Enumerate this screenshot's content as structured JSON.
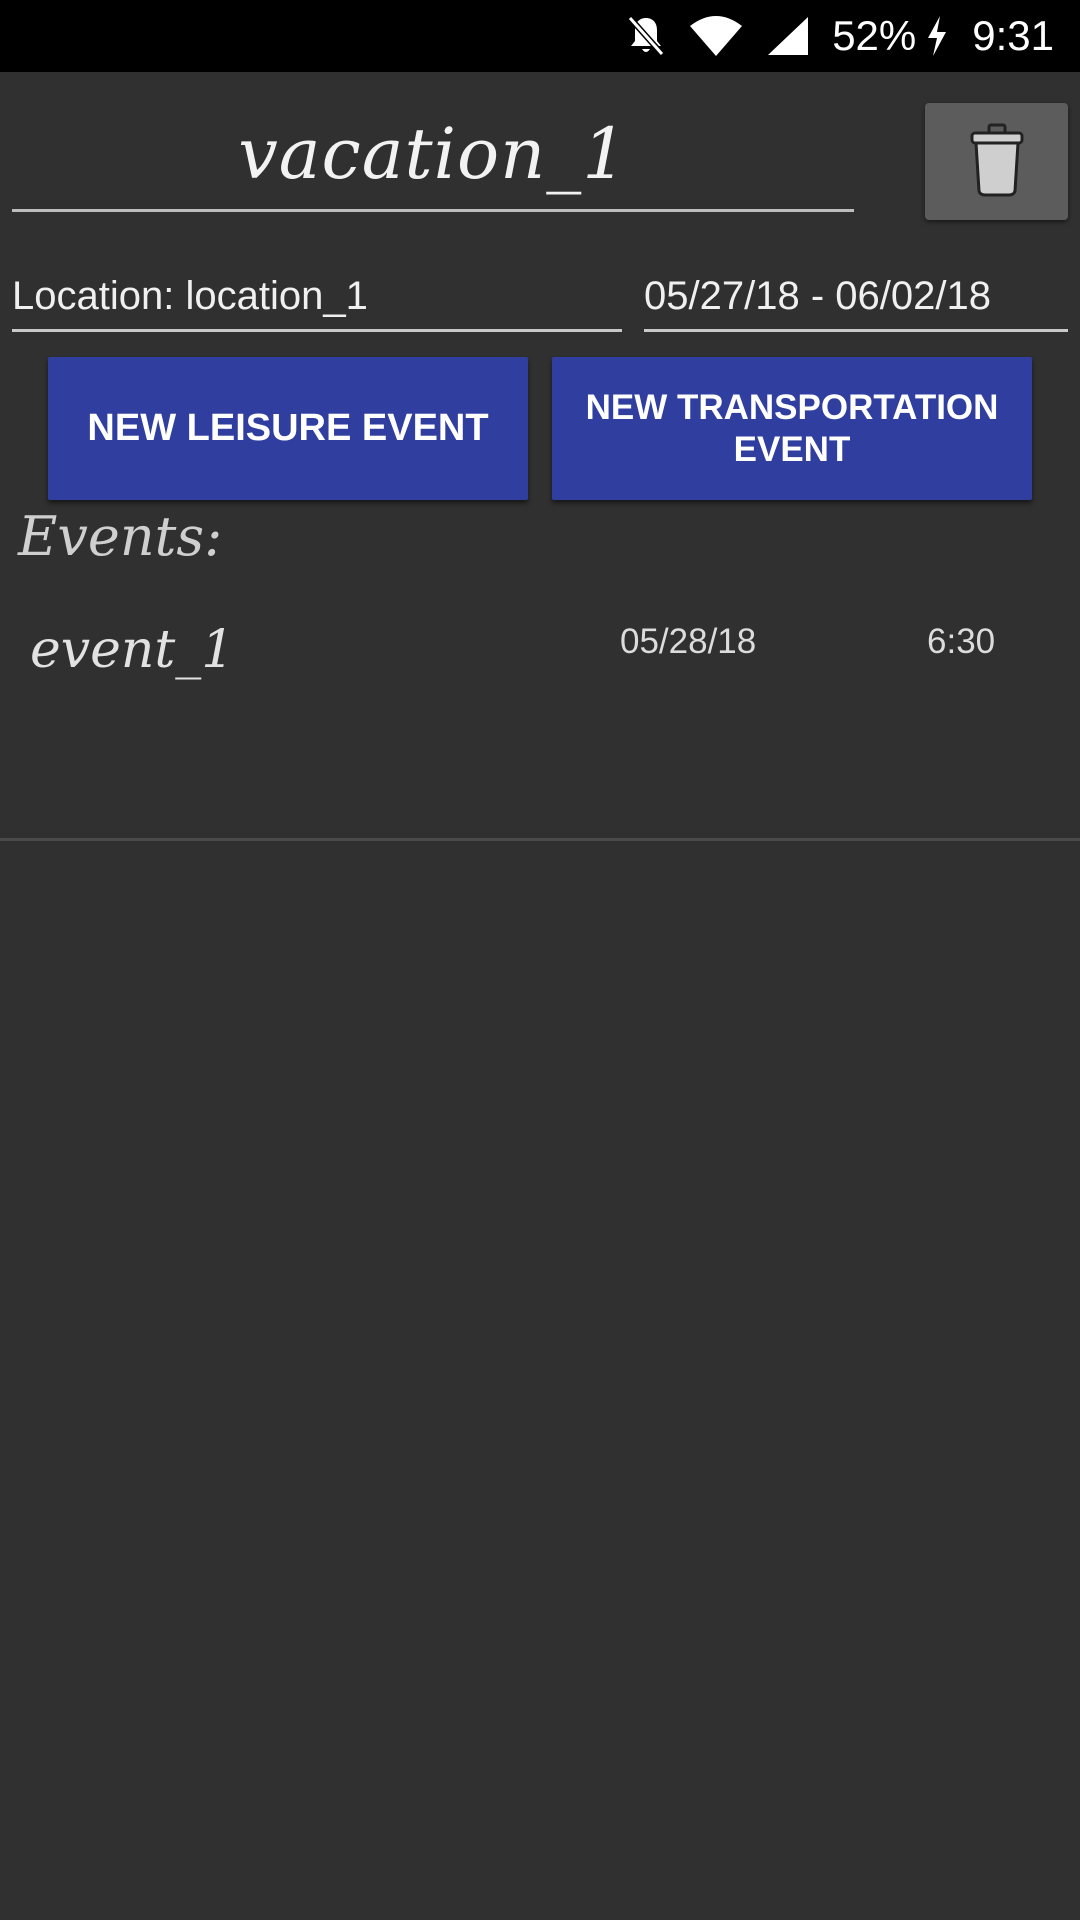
{
  "status_bar": {
    "battery": "52%",
    "time": "9:31",
    "icons": [
      "bell-off-icon",
      "wifi-icon",
      "signal-icon",
      "charging-icon"
    ]
  },
  "trip": {
    "title": "vacation_1",
    "location": "Location: location_1",
    "date_range": "05/27/18 - 06/02/18"
  },
  "toolbar": {
    "delete_icon": "trash-icon"
  },
  "buttons": {
    "new_leisure": "NEW LEISURE EVENT",
    "new_transport_line1": "NEW TRANSPORTATION",
    "new_transport_line2": "EVENT"
  },
  "events": {
    "heading": "Events:",
    "items": [
      {
        "name": "event_1",
        "date": "05/28/18",
        "time": "6:30"
      }
    ]
  },
  "colors": {
    "background": "#303030",
    "button": "#303f9f",
    "delete_button": "#5c5c5c"
  }
}
